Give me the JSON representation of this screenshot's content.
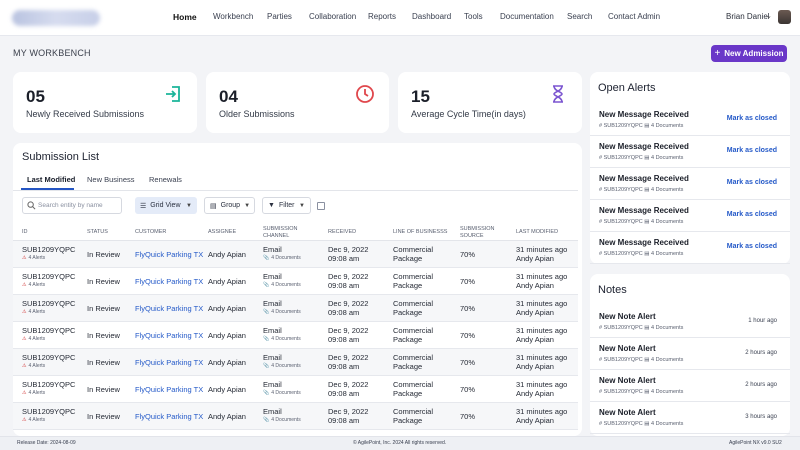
{
  "nav": {
    "items": [
      "Home",
      "Workbench",
      "Parties",
      "Collaboration",
      "Reports",
      "Dashboard",
      "Tools",
      "Documentation",
      "Search",
      "Contact Admin"
    ],
    "active": "Home",
    "user_name": "Brian Daniel"
  },
  "header": {
    "page_title": "MY WORKBENCH",
    "new_button": "New Admission"
  },
  "stats": [
    {
      "value": "05",
      "label": "Newly Received Submissions",
      "icon": "enter-icon",
      "color": "#1bb59a"
    },
    {
      "value": "04",
      "label": "Older Submissions",
      "icon": "clock-icon",
      "color": "#e0474c"
    },
    {
      "value": "15",
      "label": "Average Cycle Time(in days)",
      "icon": "hourglass-icon",
      "color": "#7b55d0"
    }
  ],
  "submissions": {
    "title": "Submission List",
    "tabs": [
      "Last Modified",
      "New Business",
      "Renewals"
    ],
    "search_placeholder": "Search entity by name",
    "grid_view": "Grid View",
    "group": "Group",
    "filter": "Filter",
    "columns": [
      "ID",
      "STATUS",
      "CUSTOMER",
      "ASSIGNEE",
      "SUBMISSION CHANNEL",
      "RECEIVED",
      "LINE OF BUSINESSS",
      "SUBMISSION SOURCE",
      "LAST MODIFIED"
    ],
    "rows": [
      {
        "id": "SUB1209YQPC",
        "alerts": "4 Alerts",
        "status": "In Review",
        "customer": "FlyQuick Parking TX",
        "assignee": "Andy Apian",
        "channel": "Email",
        "docs": "4 Documents",
        "received_date": "Dec 9, 2022",
        "received_time": "09:08 am",
        "lob1": "Commercial",
        "lob2": "Package",
        "source": "70%",
        "modified": "31 minutes ago",
        "modified_by": "Andy Apian"
      },
      {
        "id": "SUB1209YQPC",
        "alerts": "4 Alerts",
        "status": "In Review",
        "customer": "FlyQuick Parking TX",
        "assignee": "Andy Apian",
        "channel": "Email",
        "docs": "4 Documents",
        "received_date": "Dec 9, 2022",
        "received_time": "09:08 am",
        "lob1": "Commercial",
        "lob2": "Package",
        "source": "70%",
        "modified": "31 minutes ago",
        "modified_by": "Andy Apian"
      },
      {
        "id": "SUB1209YQPC",
        "alerts": "4 Alerts",
        "status": "In Review",
        "customer": "FlyQuick Parking TX",
        "assignee": "Andy Apian",
        "channel": "Email",
        "docs": "4 Documents",
        "received_date": "Dec 9, 2022",
        "received_time": "09:08 am",
        "lob1": "Commercial",
        "lob2": "Package",
        "source": "70%",
        "modified": "31 minutes ago",
        "modified_by": "Andy Apian"
      },
      {
        "id": "SUB1209YQPC",
        "alerts": "4 Alerts",
        "status": "In Review",
        "customer": "FlyQuick Parking TX",
        "assignee": "Andy Apian",
        "channel": "Email",
        "docs": "4 Documents",
        "received_date": "Dec 9, 2022",
        "received_time": "09:08 am",
        "lob1": "Commercial",
        "lob2": "Package",
        "source": "70%",
        "modified": "31 minutes ago",
        "modified_by": "Andy Apian"
      },
      {
        "id": "SUB1209YQPC",
        "alerts": "4 Alerts",
        "status": "In Review",
        "customer": "FlyQuick Parking TX",
        "assignee": "Andy Apian",
        "channel": "Email",
        "docs": "4 Documents",
        "received_date": "Dec 9, 2022",
        "received_time": "09:08 am",
        "lob1": "Commercial",
        "lob2": "Package",
        "source": "70%",
        "modified": "31 minutes ago",
        "modified_by": "Andy Apian"
      },
      {
        "id": "SUB1209YQPC",
        "alerts": "4 Alerts",
        "status": "In Review",
        "customer": "FlyQuick Parking TX",
        "assignee": "Andy Apian",
        "channel": "Email",
        "docs": "4 Documents",
        "received_date": "Dec 9, 2022",
        "received_time": "09:08 am",
        "lob1": "Commercial",
        "lob2": "Package",
        "source": "70%",
        "modified": "31 minutes ago",
        "modified_by": "Andy Apian"
      },
      {
        "id": "SUB1209YQPC",
        "alerts": "4 Alerts",
        "status": "In Review",
        "customer": "FlyQuick Parking TX",
        "assignee": "Andy Apian",
        "channel": "Email",
        "docs": "4 Documents",
        "received_date": "Dec 9, 2022",
        "received_time": "09:08 am",
        "lob1": "Commercial",
        "lob2": "Package",
        "source": "70%",
        "modified": "31 minutes ago",
        "modified_by": "Andy Apian"
      }
    ]
  },
  "alerts": {
    "title": "Open Alerts",
    "items": [
      {
        "title": "New Message Received",
        "id": "# SUB1209YQPC",
        "docs": "4 Documents",
        "action": "Mark as closed"
      },
      {
        "title": "New Message Received",
        "id": "# SUB1209YQPC",
        "docs": "4 Documents",
        "action": "Mark as closed"
      },
      {
        "title": "New Message Received",
        "id": "# SUB1209YQPC",
        "docs": "4 Documents",
        "action": "Mark as closed"
      },
      {
        "title": "New Message Received",
        "id": "# SUB1209YQPC",
        "docs": "4 Documents",
        "action": "Mark as closed"
      },
      {
        "title": "New Message Received",
        "id": "# SUB1209YQPC",
        "docs": "4 Documents",
        "action": "Mark as closed"
      }
    ]
  },
  "notes": {
    "title": "Notes",
    "items": [
      {
        "title": "New Note Alert",
        "id": "# SUB1209YQPC",
        "docs": "4 Documents",
        "time": "1 hour ago"
      },
      {
        "title": "New Note Alert",
        "id": "# SUB1209YQPC",
        "docs": "4 Documents",
        "time": "2 hours ago"
      },
      {
        "title": "New Note Alert",
        "id": "# SUB1209YQPC",
        "docs": "4 Documents",
        "time": "2 hours ago"
      },
      {
        "title": "New Note Alert",
        "id": "# SUB1209YQPC",
        "docs": "4 Documents",
        "time": "3 hours ago"
      }
    ]
  },
  "footer": {
    "release": "Release Date: 2024-08-09",
    "copyright": "© AgilePoint, Inc. 2024 All rights reserved.",
    "version": "AgilePoint NX v9.0 SU2"
  }
}
